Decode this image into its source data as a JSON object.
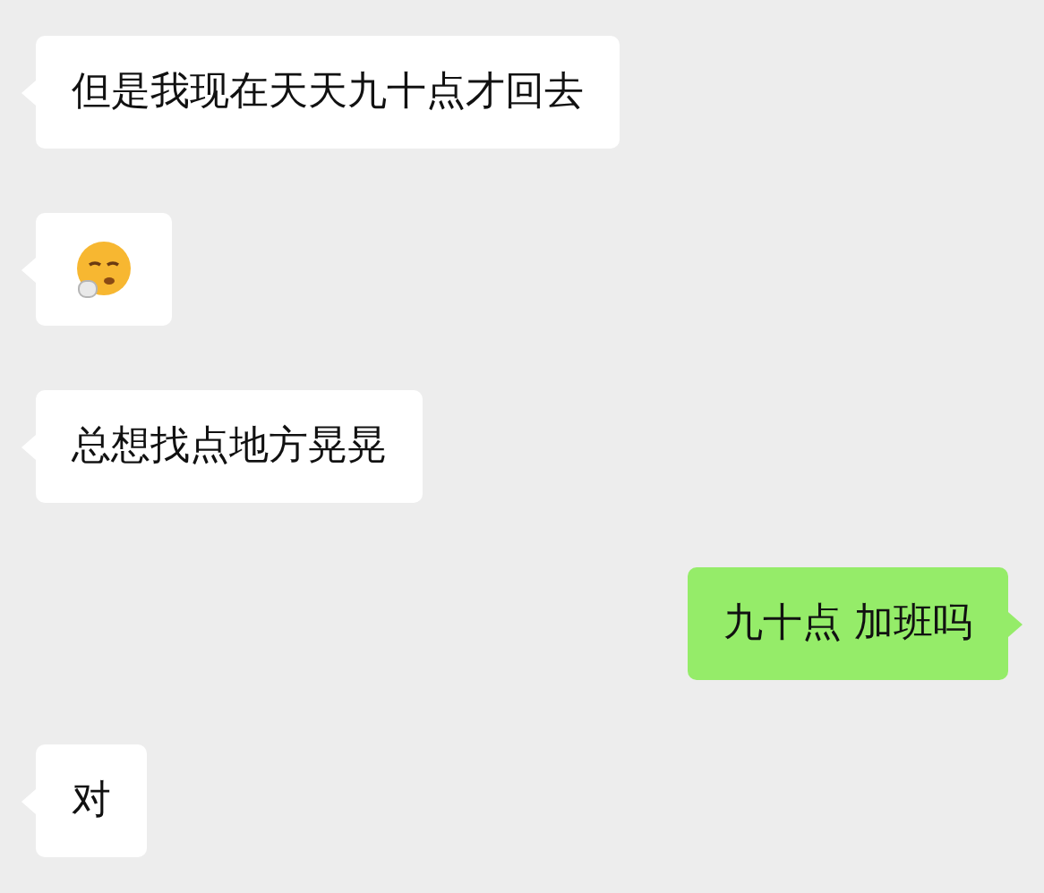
{
  "messages": [
    {
      "outgoing": false,
      "kind": "text",
      "text": "但是我现在天天九十点才回去"
    },
    {
      "outgoing": false,
      "kind": "emoji"
    },
    {
      "outgoing": false,
      "kind": "text",
      "text": "总想找点地方晃晃"
    },
    {
      "outgoing": true,
      "kind": "text",
      "text": "九十点 加班吗"
    },
    {
      "outgoing": false,
      "kind": "text",
      "text": "对"
    }
  ]
}
